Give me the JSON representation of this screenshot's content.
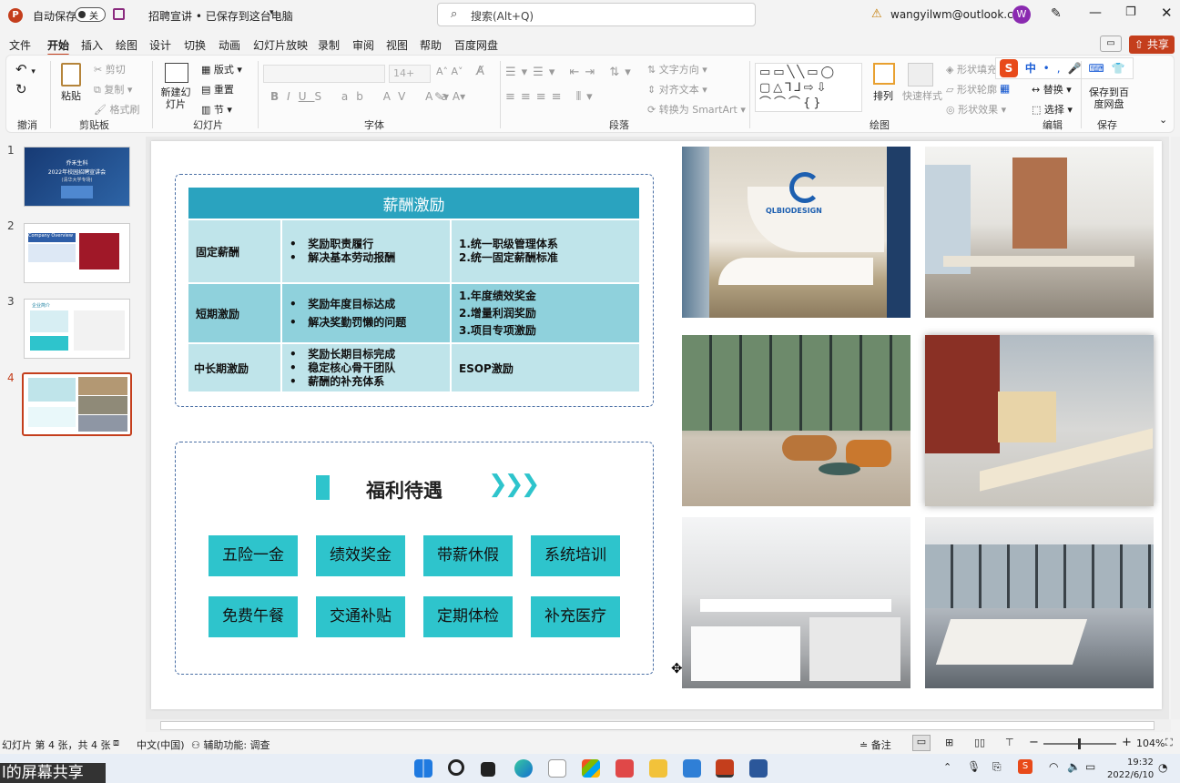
{
  "app": {
    "autosave_label": "自动保存",
    "autosave_state": "关",
    "doc_title": "招聘宣讲 • 已保存到这台电脑",
    "search_placeholder": "搜索(Alt+Q)",
    "account_email": "wangyilwm@outlook.com",
    "avatar_letter": "W",
    "share_label": "共享"
  },
  "tabs": [
    "文件",
    "开始",
    "插入",
    "绘图",
    "设计",
    "切换",
    "动画",
    "幻灯片放映",
    "录制",
    "审阅",
    "视图",
    "帮助",
    "百度网盘"
  ],
  "ribbon": {
    "undo_group": "撤消",
    "clipboard": {
      "paste": "粘贴",
      "cut": "剪切",
      "copy": "复制",
      "format_painter": "格式刷",
      "group": "剪贴板"
    },
    "slides": {
      "new_slide": "新建幻灯片",
      "layout": "版式",
      "reset": "重置",
      "section": "节",
      "group": "幻灯片"
    },
    "font": {
      "size": "14+",
      "group": "字体"
    },
    "paragraph": {
      "text_direction": "文字方向",
      "align_text": "对齐文本",
      "smartart": "转换为 SmartArt",
      "group": "段落"
    },
    "drawing": {
      "arrange": "排列",
      "quick_styles": "快速样式",
      "fill": "形状填充",
      "outline": "形状轮廓",
      "effects": "形状效果",
      "group": "绘图"
    },
    "editing": {
      "replace": "替换",
      "select": "选择",
      "group": "编辑"
    },
    "save": {
      "save_baidu": "保存到百度网盘",
      "group": "保存"
    }
  },
  "thumbnails": [
    {
      "num": "1",
      "title": "乔禾生科",
      "subtitle": "2022年校园招聘宣讲会",
      "note": "(清华大学专场)"
    },
    {
      "num": "2",
      "title": "Company Overview"
    },
    {
      "num": "3",
      "title": "企业简介"
    },
    {
      "num": "4",
      "active": true
    }
  ],
  "slide": {
    "pay_title": "薪酬激励",
    "pay_rows": [
      {
        "type": "固定薪酬",
        "items": [
          "奖励职责履行",
          "解决基本劳动报酬"
        ],
        "plan": [
          "1.统一职级管理体系",
          "2.统一固定薪酬标准"
        ]
      },
      {
        "type": "短期激励",
        "items": [
          "奖励年度目标达成",
          "解决奖勤罚懒的问题"
        ],
        "plan": [
          "1.年度绩效奖金",
          "2.增量利润奖励",
          "3.项目专项激励"
        ]
      },
      {
        "type": "中长期激励",
        "items": [
          "奖励长期目标完成",
          "稳定核心骨干团队",
          "薪酬的补充体系"
        ],
        "plan": [
          "ESOP激励"
        ]
      }
    ],
    "benefits_title": "福利待遇",
    "benefits": [
      "五险一金",
      "绩效奖金",
      "带薪休假",
      "系统培训",
      "免费午餐",
      "交通补贴",
      "定期体检",
      "补充医疗"
    ],
    "logo_text": "QLBIODESIGN"
  },
  "status": {
    "slide_info": "幻灯片 第 4 张，共 4 张",
    "language": "中文(中国)",
    "accessibility": "辅助功能: 调查",
    "notes": "备注",
    "zoom": "104%"
  },
  "taskbar": {
    "share_overlay": "l的屏幕共享",
    "time": "19:32",
    "date": "2022/6/10",
    "ime": "中"
  },
  "colors": {
    "accent": "#c43e1c",
    "teal": "#2ec4cc",
    "table_header": "#2aa3bf",
    "cell_light": "#bfe4ea",
    "cell_mid": "#8fd1dc"
  }
}
